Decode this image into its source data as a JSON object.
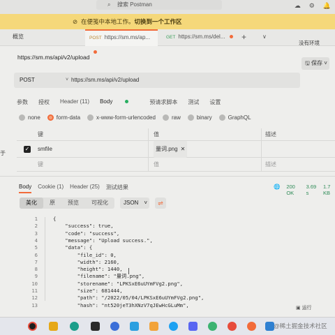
{
  "topbar": {
    "search_placeholder": "搜索 Postman",
    "search_icon": "search-icon",
    "icons": [
      "cloud-icon",
      "gear-icon",
      "bell-icon"
    ]
  },
  "banner": {
    "prefix": "在便笺中本地工作。",
    "link": "切换到一个工作区",
    "icon": "cloud-off-icon"
  },
  "tabs": {
    "overview": "概览",
    "items": [
      {
        "method": "POST",
        "label": "https://sm.ms/ap...",
        "active": true
      },
      {
        "method": "GET",
        "label": "https://sm.ms/del...",
        "active": false
      }
    ],
    "plus": "+",
    "more": "∨",
    "env": "没有环境"
  },
  "request": {
    "title": "https://sm.ms/api/v2/upload",
    "save_label": "保存",
    "method": "POST",
    "url": "https://sm.ms/api/v2/upload",
    "tabs": [
      "参数",
      "授权",
      "Header (11)",
      "Body",
      "预请求脚本",
      "测试",
      "设置"
    ],
    "active_tab": "Body",
    "body_types": [
      "none",
      "form-data",
      "x-www-form-urlencoded",
      "raw",
      "binary",
      "GraphQL"
    ],
    "selected_body_type": "form-data",
    "table": {
      "headers": {
        "key": "键",
        "value": "值",
        "desc": "描述"
      },
      "rows": [
        {
          "checked": true,
          "key": "smfile",
          "value": "量词.png",
          "desc": ""
        }
      ],
      "placeholder": {
        "key": "键",
        "value": "值",
        "desc": "描述"
      }
    },
    "left_edge": "于"
  },
  "response": {
    "tabs": [
      "Body",
      "Cookie (1)",
      "Header (25)",
      "测试结果"
    ],
    "active_tab": "Body",
    "status": {
      "code": "200 OK",
      "time": "3.69 s",
      "size": "1.7 KB",
      "icon": "globe-icon"
    },
    "views": [
      "美化",
      "原",
      "预览",
      "可视化"
    ],
    "active_view": "美化",
    "format": "JSON",
    "wrap_icon": "wrap-lines-icon",
    "lines": [
      {
        "n": "1",
        "t": "{"
      },
      {
        "n": "2",
        "t": "    \"success\": true,"
      },
      {
        "n": "3",
        "t": "    \"code\": \"success\","
      },
      {
        "n": "4",
        "t": "    \"message\": \"Upload success.\","
      },
      {
        "n": "5",
        "t": "    \"data\": {"
      },
      {
        "n": "6",
        "t": "        \"file_id\": 0,"
      },
      {
        "n": "7",
        "t": "        \"width\": 2160,"
      },
      {
        "n": "8",
        "t": "        \"height\": 1440,"
      },
      {
        "n": "9",
        "t": "        \"filename\": \"量词.png\","
      },
      {
        "n": "10",
        "t": "        \"storename\": \"LPKSxE6uUYmFVg2.png\","
      },
      {
        "n": "11",
        "t": "        \"size\": 681444,"
      },
      {
        "n": "12",
        "t": "        \"path\": \"/2022/05/04/LPKSxE6uUYmFVg2.png\","
      },
      {
        "n": "13",
        "t": "        \"hash\": \"nt520jeT3hXNzV7qJEwHcGLuMm\","
      }
    ],
    "footer": "运行"
  },
  "watermark": "@稀土掘金技术社区",
  "colors": {
    "accent": "#f26b3a",
    "banner": "#f5d87a",
    "success": "#27ae60"
  }
}
